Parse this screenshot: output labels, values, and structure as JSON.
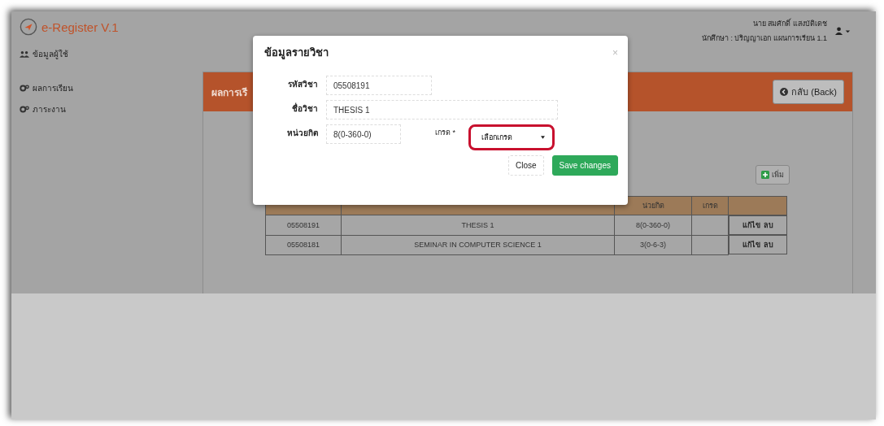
{
  "brand": {
    "name": "e-Register V.1"
  },
  "sidebar": {
    "items": [
      {
        "label": "ข้อมูลผู้ใช้",
        "kind": "users"
      },
      {
        "label": "ผลการเรียน",
        "kind": "gears"
      },
      {
        "label": "ภาระงาน",
        "kind": "gears"
      }
    ]
  },
  "user": {
    "name": "นาย สมศักดิ์ แสงบัติเดช",
    "role": "นักศึกษา : ปริญญาเอก แผนการเรียน 1.1"
  },
  "panel": {
    "title": "ผลการเรี",
    "back_button": "กลับ (Back)",
    "add_button": "เพิ่ม"
  },
  "table": {
    "columns": [
      "น่วยกิต",
      "เกรด"
    ],
    "rows": [
      {
        "code": "05508191",
        "name": "THESIS 1",
        "credits": "8(0-360-0)",
        "actions": [
          "แก้ไข",
          "ลบ"
        ]
      },
      {
        "code": "05508181",
        "name": "SEMINAR IN COMPUTER SCIENCE 1",
        "credits": "3(0-6-3)",
        "actions": [
          "แก้ไข",
          "ลบ"
        ]
      }
    ]
  },
  "modal": {
    "title": "ข้อมูลรายวิชา",
    "close": "×",
    "fields": [
      {
        "label": "รหัสวิชา",
        "value": "05508191",
        "kind": "short"
      },
      {
        "label": "ชื่อวิชา",
        "value": "THESIS 1",
        "kind": "wide"
      }
    ],
    "credit": {
      "label": "หน่วยกิต",
      "value": "8(0-360-0)"
    },
    "grade": {
      "label": "เกรด *",
      "placeholder": "เลือกเกรด",
      "highlight": true
    },
    "buttons": [
      {
        "label": "Close",
        "kind": "default"
      },
      {
        "label": "Save changes",
        "kind": "primary"
      }
    ]
  }
}
